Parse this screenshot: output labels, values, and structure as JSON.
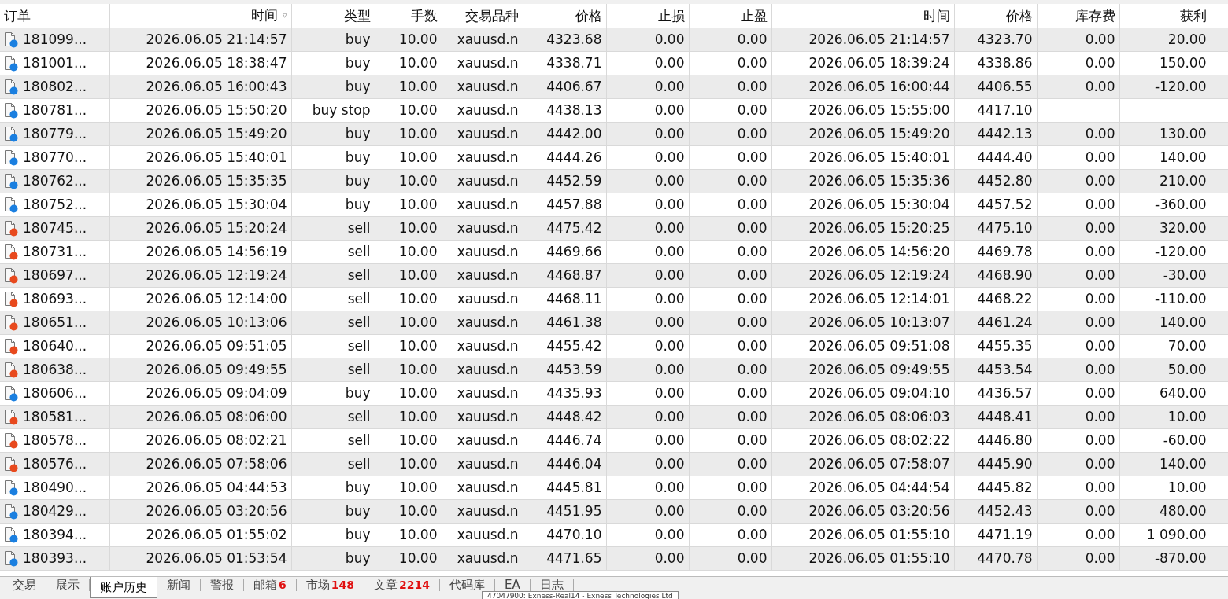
{
  "table": {
    "columns": [
      {
        "label": "订单"
      },
      {
        "label": "时间",
        "sort_mark": "▿"
      },
      {
        "label": "类型"
      },
      {
        "label": "手数"
      },
      {
        "label": "交易品种"
      },
      {
        "label": "价格"
      },
      {
        "label": "止损"
      },
      {
        "label": "止盈"
      },
      {
        "label": "时间"
      },
      {
        "label": "价格"
      },
      {
        "label": "库存费"
      },
      {
        "label": "获利"
      }
    ],
    "rows": [
      {
        "color": "#1a7fe0",
        "cells": [
          "181099...",
          "2026.06.05 21:14:57",
          "buy",
          "10.00",
          "xauusd.n",
          "4323.68",
          "0.00",
          "0.00",
          "2026.06.05 21:14:57",
          "4323.70",
          "0.00",
          "20.00"
        ]
      },
      {
        "color": "#1a7fe0",
        "cells": [
          "181001...",
          "2026.06.05 18:38:47",
          "buy",
          "10.00",
          "xauusd.n",
          "4338.71",
          "0.00",
          "0.00",
          "2026.06.05 18:39:24",
          "4338.86",
          "0.00",
          "150.00"
        ]
      },
      {
        "color": "#1a7fe0",
        "cells": [
          "180802...",
          "2026.06.05 16:00:43",
          "buy",
          "10.00",
          "xauusd.n",
          "4406.67",
          "0.00",
          "0.00",
          "2026.06.05 16:00:44",
          "4406.55",
          "0.00",
          "-120.00"
        ]
      },
      {
        "color": "#1a7fe0",
        "cells": [
          "180781...",
          "2026.06.05 15:50:20",
          "buy stop",
          "10.00",
          "xauusd.n",
          "4438.13",
          "0.00",
          "0.00",
          "2026.06.05 15:55:00",
          "4417.10",
          "",
          ""
        ]
      },
      {
        "color": "#1a7fe0",
        "cells": [
          "180779...",
          "2026.06.05 15:49:20",
          "buy",
          "10.00",
          "xauusd.n",
          "4442.00",
          "0.00",
          "0.00",
          "2026.06.05 15:49:20",
          "4442.13",
          "0.00",
          "130.00"
        ]
      },
      {
        "color": "#1a7fe0",
        "cells": [
          "180770...",
          "2026.06.05 15:40:01",
          "buy",
          "10.00",
          "xauusd.n",
          "4444.26",
          "0.00",
          "0.00",
          "2026.06.05 15:40:01",
          "4444.40",
          "0.00",
          "140.00"
        ]
      },
      {
        "color": "#1a7fe0",
        "cells": [
          "180762...",
          "2026.06.05 15:35:35",
          "buy",
          "10.00",
          "xauusd.n",
          "4452.59",
          "0.00",
          "0.00",
          "2026.06.05 15:35:36",
          "4452.80",
          "0.00",
          "210.00"
        ]
      },
      {
        "color": "#1a7fe0",
        "cells": [
          "180752...",
          "2026.06.05 15:30:04",
          "buy",
          "10.00",
          "xauusd.n",
          "4457.88",
          "0.00",
          "0.00",
          "2026.06.05 15:30:04",
          "4457.52",
          "0.00",
          "-360.00"
        ]
      },
      {
        "color": "#e8491d",
        "cells": [
          "180745...",
          "2026.06.05 15:20:24",
          "sell",
          "10.00",
          "xauusd.n",
          "4475.42",
          "0.00",
          "0.00",
          "2026.06.05 15:20:25",
          "4475.10",
          "0.00",
          "320.00"
        ]
      },
      {
        "color": "#e8491d",
        "cells": [
          "180731...",
          "2026.06.05 14:56:19",
          "sell",
          "10.00",
          "xauusd.n",
          "4469.66",
          "0.00",
          "0.00",
          "2026.06.05 14:56:20",
          "4469.78",
          "0.00",
          "-120.00"
        ]
      },
      {
        "color": "#e8491d",
        "cells": [
          "180697...",
          "2026.06.05 12:19:24",
          "sell",
          "10.00",
          "xauusd.n",
          "4468.87",
          "0.00",
          "0.00",
          "2026.06.05 12:19:24",
          "4468.90",
          "0.00",
          "-30.00"
        ]
      },
      {
        "color": "#e8491d",
        "cells": [
          "180693...",
          "2026.06.05 12:14:00",
          "sell",
          "10.00",
          "xauusd.n",
          "4468.11",
          "0.00",
          "0.00",
          "2026.06.05 12:14:01",
          "4468.22",
          "0.00",
          "-110.00"
        ]
      },
      {
        "color": "#e8491d",
        "cells": [
          "180651...",
          "2026.06.05 10:13:06",
          "sell",
          "10.00",
          "xauusd.n",
          "4461.38",
          "0.00",
          "0.00",
          "2026.06.05 10:13:07",
          "4461.24",
          "0.00",
          "140.00"
        ]
      },
      {
        "color": "#e8491d",
        "cells": [
          "180640...",
          "2026.06.05 09:51:05",
          "sell",
          "10.00",
          "xauusd.n",
          "4455.42",
          "0.00",
          "0.00",
          "2026.06.05 09:51:08",
          "4455.35",
          "0.00",
          "70.00"
        ]
      },
      {
        "color": "#e8491d",
        "cells": [
          "180638...",
          "2026.06.05 09:49:55",
          "sell",
          "10.00",
          "xauusd.n",
          "4453.59",
          "0.00",
          "0.00",
          "2026.06.05 09:49:55",
          "4453.54",
          "0.00",
          "50.00"
        ]
      },
      {
        "color": "#1a7fe0",
        "cells": [
          "180606...",
          "2026.06.05 09:04:09",
          "buy",
          "10.00",
          "xauusd.n",
          "4435.93",
          "0.00",
          "0.00",
          "2026.06.05 09:04:10",
          "4436.57",
          "0.00",
          "640.00"
        ]
      },
      {
        "color": "#e8491d",
        "cells": [
          "180581...",
          "2026.06.05 08:06:00",
          "sell",
          "10.00",
          "xauusd.n",
          "4448.42",
          "0.00",
          "0.00",
          "2026.06.05 08:06:03",
          "4448.41",
          "0.00",
          "10.00"
        ]
      },
      {
        "color": "#e8491d",
        "cells": [
          "180578...",
          "2026.06.05 08:02:21",
          "sell",
          "10.00",
          "xauusd.n",
          "4446.74",
          "0.00",
          "0.00",
          "2026.06.05 08:02:22",
          "4446.80",
          "0.00",
          "-60.00"
        ]
      },
      {
        "color": "#e8491d",
        "cells": [
          "180576...",
          "2026.06.05 07:58:06",
          "sell",
          "10.00",
          "xauusd.n",
          "4446.04",
          "0.00",
          "0.00",
          "2026.06.05 07:58:07",
          "4445.90",
          "0.00",
          "140.00"
        ]
      },
      {
        "color": "#1a7fe0",
        "cells": [
          "180490...",
          "2026.06.05 04:44:53",
          "buy",
          "10.00",
          "xauusd.n",
          "4445.81",
          "0.00",
          "0.00",
          "2026.06.05 04:44:54",
          "4445.82",
          "0.00",
          "10.00"
        ]
      },
      {
        "color": "#1a7fe0",
        "cells": [
          "180429...",
          "2026.06.05 03:20:56",
          "buy",
          "10.00",
          "xauusd.n",
          "4451.95",
          "0.00",
          "0.00",
          "2026.06.05 03:20:56",
          "4452.43",
          "0.00",
          "480.00"
        ]
      },
      {
        "color": "#1a7fe0",
        "cells": [
          "180394...",
          "2026.06.05 01:55:02",
          "buy",
          "10.00",
          "xauusd.n",
          "4470.10",
          "0.00",
          "0.00",
          "2026.06.05 01:55:10",
          "4471.19",
          "0.00",
          "1 090.00"
        ]
      },
      {
        "color": "#1a7fe0",
        "cells": [
          "180393...",
          "2026.06.05 01:53:54",
          "buy",
          "10.00",
          "xauusd.n",
          "4471.65",
          "0.00",
          "0.00",
          "2026.06.05 01:55:10",
          "4470.78",
          "0.00",
          "-870.00"
        ]
      }
    ]
  },
  "tabs": [
    {
      "label": "交易",
      "selected": false
    },
    {
      "label": "展示",
      "selected": false
    },
    {
      "label": "账户历史",
      "selected": true
    },
    {
      "label": "新闻",
      "selected": false
    },
    {
      "label": "警报",
      "selected": false
    },
    {
      "label": "邮箱",
      "badge": "6",
      "selected": false
    },
    {
      "label": "市场",
      "badge": "148",
      "selected": false
    },
    {
      "label": "文章",
      "badge": "2214",
      "selected": false
    },
    {
      "label": "代码库",
      "selected": false
    },
    {
      "label": "EA",
      "selected": false
    },
    {
      "label": "日志",
      "selected": false
    }
  ],
  "tooltip": {
    "text": "47047900: Exness-Real14 - Exness Technologies Ltd"
  }
}
